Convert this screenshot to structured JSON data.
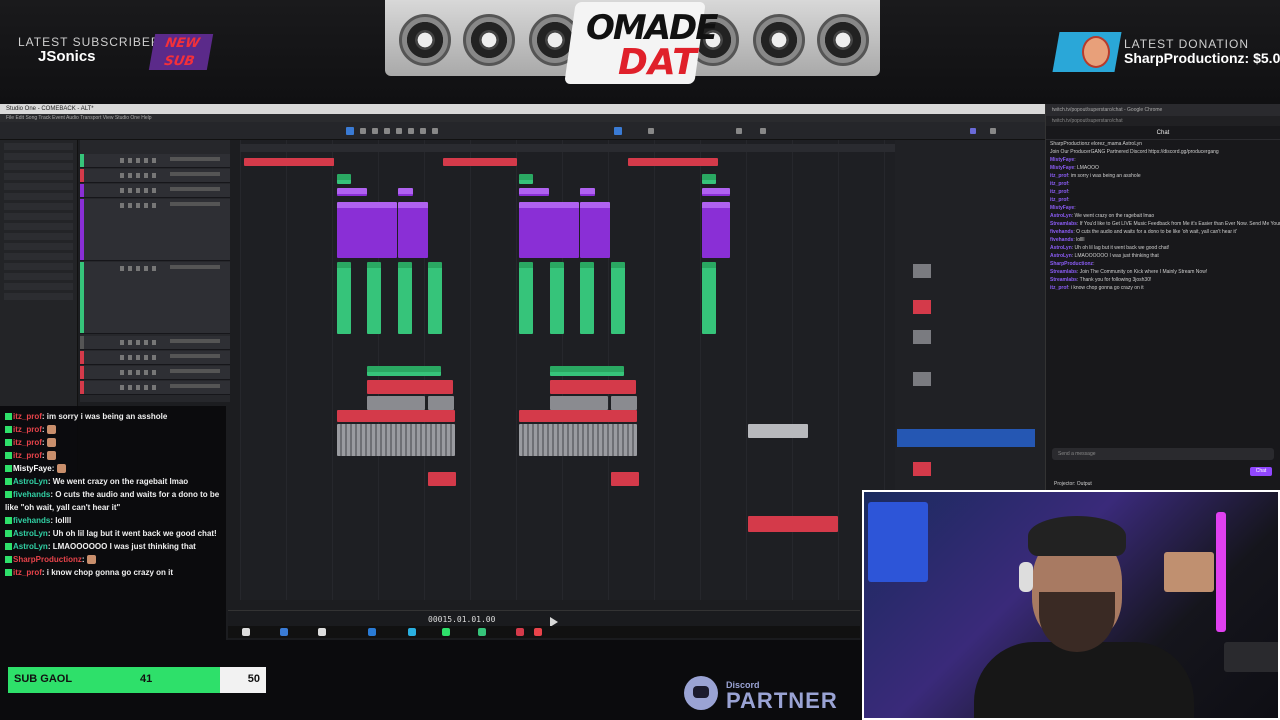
{
  "banner": {
    "subscriber_label": "LATEST SUBSCRIBER",
    "subscriber_name": "JSonics",
    "new_sub_line1": "NEW",
    "new_sub_line2": "SUB",
    "donation_label": "LATEST DONATION",
    "donation_name": "SharpProductionz: $5.0",
    "logo_line1": "OMADE",
    "logo_line2": "DAT"
  },
  "daw": {
    "window_title": "Studio One - COMEBACK - ALT*",
    "menu": "File  Edit  Song  Track  Event  Audio  Transport  View  Studio One  Help",
    "time_display": "00015.01.01.00"
  },
  "chat_window": {
    "tab_title": "twitch.tv/popout/superstaro/chat - Google Chrome",
    "url": "twitch.tv/popout/superstaro/chat",
    "title": "Chat",
    "pinned": "SharpProductionz   elorez_mama   AstroLyn",
    "messages": [
      {
        "user": "",
        "text": "Join Our ProducerGANG Partnered Discord https://discord.gg/producergang"
      },
      {
        "user": "MistyFaye",
        "text": ""
      },
      {
        "user": "MistyFaye",
        "text": "LMAOOO"
      },
      {
        "user": "itz_prof",
        "text": "im sorry i was being an asshole"
      },
      {
        "user": "itz_prof",
        "text": ""
      },
      {
        "user": "itz_prof",
        "text": ""
      },
      {
        "user": "itz_prof",
        "text": ""
      },
      {
        "user": "MistyFaye",
        "text": ""
      },
      {
        "user": "AstroLyn",
        "text": "We went crazy on the ragebait lmao"
      },
      {
        "user": "Streamlabs",
        "text": "If You'd like to Get LIVE Music Feedback from Me it's Easier than Ever Now. Send Me Your Music, Beats, Loops & Ideas Now!"
      },
      {
        "user": "fivehands",
        "text": "O cuts the audio and waits for a dono to be like 'oh wait, yall can't hear it'"
      },
      {
        "user": "fivehands",
        "text": "lollll"
      },
      {
        "user": "AstroLyn",
        "text": "Uh oh lil lag but it went back we good chat!"
      },
      {
        "user": "AstroLyn",
        "text": "LMAOOOOOO I was just thinking that"
      },
      {
        "user": "SharpProductionz",
        "text": ""
      },
      {
        "user": "Streamlabs",
        "text": "Join The Community on Kick where I Mainly Stream Now!"
      },
      {
        "user": "Streamlabs",
        "text": "Thank you for following 3josh30!"
      },
      {
        "user": "itz_prof",
        "text": "i know chop gonna go crazy on it"
      }
    ],
    "input_placeholder": "Send a message",
    "chat_button": "Chat",
    "status": "Projector: Output"
  },
  "left_chat": [
    {
      "user": "itz_prof",
      "color": "red",
      "text": ": im sorry i was being an asshole",
      "emote": false
    },
    {
      "user": "itz_prof",
      "color": "red",
      "text": ":",
      "emote": true
    },
    {
      "user": "itz_prof",
      "color": "red",
      "text": ":",
      "emote": true
    },
    {
      "user": "itz_prof",
      "color": "red",
      "text": ":",
      "emote": true
    },
    {
      "user": "MistyFaye",
      "color": "white",
      "text": ":",
      "emote": true
    },
    {
      "user": "AstroLyn",
      "color": "green",
      "text": ": We went crazy on the ragebait lmao",
      "emote": false
    },
    {
      "user": "fivehands",
      "color": "green",
      "text": ": O cuts the audio and waits for a dono to be like \"oh wait, yall can't hear it\"",
      "emote": false
    },
    {
      "user": "fivehands",
      "color": "green",
      "text": ": lollll",
      "emote": false
    },
    {
      "user": "AstroLyn",
      "color": "green",
      "text": ": Uh oh lil lag but it went back we good chat!",
      "emote": false
    },
    {
      "user": "AstroLyn",
      "color": "green",
      "text": ": LMAOOOOOO I was just thinking that",
      "emote": false
    },
    {
      "user": "SharpProductionz",
      "color": "red",
      "text": ":",
      "emote": true
    },
    {
      "user": "itz_prof",
      "color": "red",
      "text": ": i know chop gonna go crazy on it",
      "emote": false
    }
  ],
  "sub_goal": {
    "label": "SUB GAOL",
    "current": "41",
    "max": "50",
    "progress": 0.82,
    "fill_color": "#2ee06a"
  },
  "discord_partner": {
    "line1": "Discord",
    "line2": "PARTNER"
  },
  "colors": {
    "purple_clip": "#8a2fd6",
    "green_clip": "#36c47a",
    "red_clip": "#d43a4a",
    "selection_blue": "#2557b3",
    "twitch_purple": "#9147ff"
  }
}
